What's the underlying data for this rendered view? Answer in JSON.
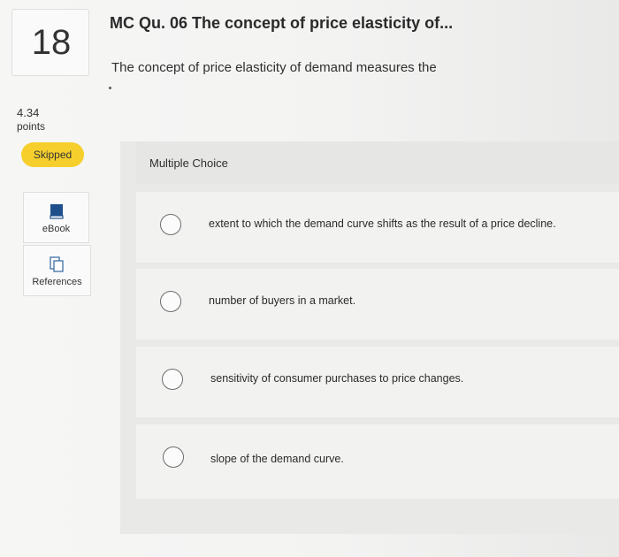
{
  "question": {
    "number": "18",
    "title": "MC Qu. 06 The concept of price elasticity of...",
    "text": "The concept of price elasticity of demand measures the",
    "points_value": "4.34",
    "points_label": "points",
    "status": "Skipped"
  },
  "tools": {
    "ebook_label": "eBook",
    "references_label": "References",
    "ebook_icon": "book-icon",
    "references_icon": "documents-icon"
  },
  "answer_area": {
    "header": "Multiple Choice",
    "options": [
      {
        "label": "extent to which the demand curve shifts as the result of a price decline."
      },
      {
        "label": "number of buyers in a market."
      },
      {
        "label": "sensitivity of consumer purchases to price changes."
      },
      {
        "label": "slope of the demand curve."
      }
    ]
  },
  "colors": {
    "status_badge": "#f6cf2c",
    "ebook_icon": "#1f4f8a",
    "background": "#f3f3f2"
  }
}
